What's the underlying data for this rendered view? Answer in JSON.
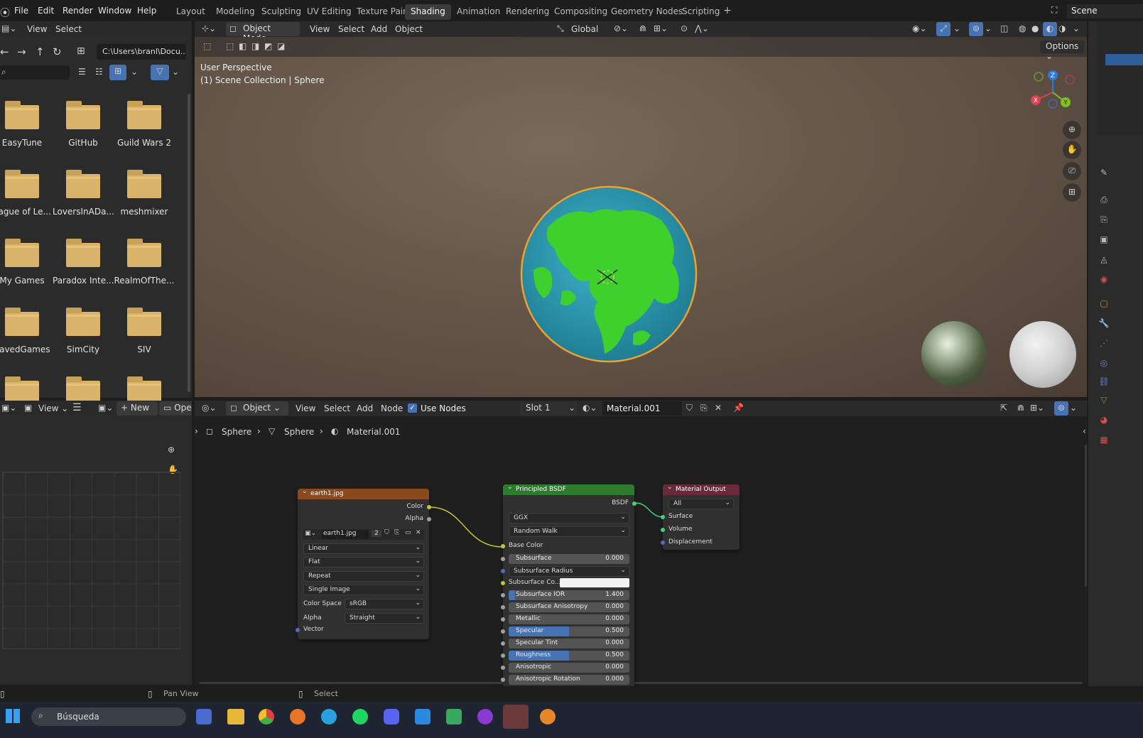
{
  "topmenu": {
    "items": [
      "File",
      "Edit",
      "Render",
      "Window",
      "Help"
    ]
  },
  "workspaces": {
    "tabs": [
      "Layout",
      "Modeling",
      "Sculpting",
      "UV Editing",
      "Texture Paint",
      "Shading",
      "Animation",
      "Rendering",
      "Compositing",
      "Geometry Nodes",
      "Scripting"
    ],
    "active": "Shading",
    "add": "+"
  },
  "scene": {
    "label": "Scene"
  },
  "filebrowser": {
    "menu": [
      "View",
      "Select"
    ],
    "path": "C:\\Users\\branl\\Docu...",
    "folders": [
      "EasyTune",
      "GitHub",
      "Guild Wars 2",
      "eague of Le...",
      "LoversInADa...",
      "meshmixer",
      "My Games",
      "Paradox Inte...",
      "RealmOfThe...",
      "SavedGames",
      "SimCity",
      "SIV"
    ]
  },
  "viewport": {
    "mode": "Object Mode",
    "menu": [
      "View",
      "Select",
      "Add",
      "Object"
    ],
    "transform": "Global",
    "options": "Options",
    "overlay_title": "User Perspective",
    "overlay_sub": "(1) Scene Collection | Sphere",
    "gizmo": {
      "x": "X",
      "y": "Y",
      "z": "Z"
    }
  },
  "imageeditor": {
    "view": "View",
    "new": "New",
    "open": "Oper"
  },
  "nodeeditor": {
    "type": "Object",
    "menu": [
      "View",
      "Select",
      "Add",
      "Node"
    ],
    "use_nodes": "Use Nodes",
    "slot": "Slot 1",
    "material": "Material.001",
    "breadcrumb": [
      "Sphere",
      "Sphere",
      "Material.001"
    ]
  },
  "nodes": {
    "image": {
      "title": "earth1.jpg",
      "out_color": "Color",
      "out_alpha": "Alpha",
      "file": "earth1.jpg",
      "users": "2",
      "interp": "Linear",
      "proj": "Flat",
      "ext": "Repeat",
      "source": "Single Image",
      "cs_label": "Color Space",
      "cs_value": "sRGB",
      "alpha_label": "Alpha",
      "alpha_value": "Straight",
      "vector": "Vector"
    },
    "bsdf": {
      "title": "Principled BSDF",
      "out": "BSDF",
      "dist": "GGX",
      "ss_method": "Random Walk",
      "base_color": "Base Color",
      "fields": [
        {
          "label": "Subsurface",
          "value": "0.000",
          "fill": 0
        },
        {
          "label": "Subsurface IOR",
          "value": "1.400",
          "fill": 0.05
        },
        {
          "label": "Subsurface Anisotropy",
          "value": "0.000",
          "fill": 0
        },
        {
          "label": "Metallic",
          "value": "0.000",
          "fill": 0
        },
        {
          "label": "Specular",
          "value": "0.500",
          "fill": 0.5
        },
        {
          "label": "Specular Tint",
          "value": "0.000",
          "fill": 0
        },
        {
          "label": "Roughness",
          "value": "0.500",
          "fill": 0.5
        },
        {
          "label": "Anisotropic",
          "value": "0.000",
          "fill": 0
        },
        {
          "label": "Anisotropic Rotation",
          "value": "0.000",
          "fill": 0
        }
      ],
      "ss_radius": "Subsurface Radius",
      "ss_color": "Subsurface Co..."
    },
    "output": {
      "title": "Material Output",
      "target": "All",
      "surface": "Surface",
      "volume": "Volume",
      "displacement": "Displacement"
    }
  },
  "statusbar": {
    "pan": "Pan View",
    "select": "Select"
  },
  "taskbar": {
    "search": "Búsqueda"
  }
}
